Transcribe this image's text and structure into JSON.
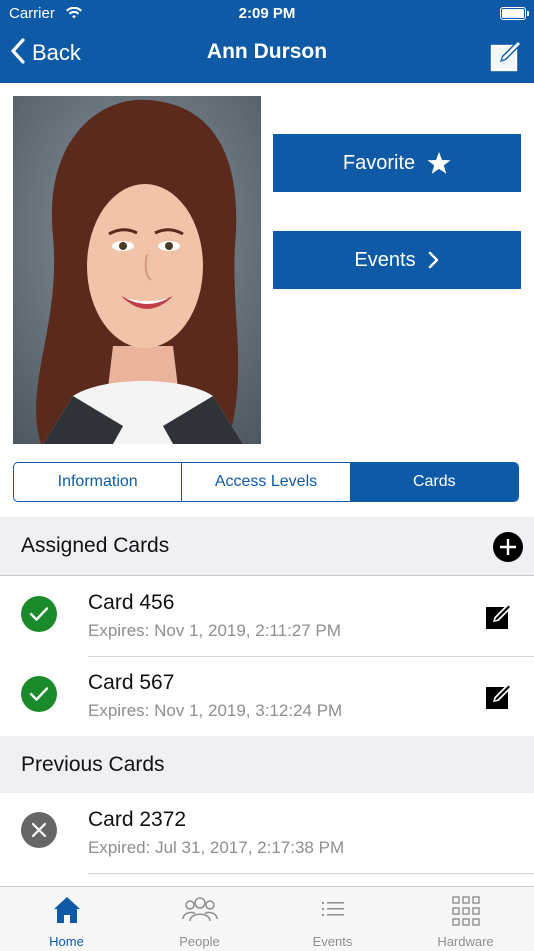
{
  "status_bar": {
    "carrier": "Carrier",
    "time": "2:09 PM"
  },
  "nav": {
    "back_label": "Back",
    "title": "Ann Durson"
  },
  "actions": {
    "favorite_label": "Favorite",
    "events_label": "Events"
  },
  "segments": [
    {
      "label": "Information",
      "active": false
    },
    {
      "label": "Access Levels",
      "active": false
    },
    {
      "label": "Cards",
      "active": true
    }
  ],
  "assigned": {
    "title": "Assigned Cards",
    "cards": [
      {
        "name": "Card 456",
        "expires": "Expires: Nov 1, 2019, 2:11:27 PM",
        "status": "active"
      },
      {
        "name": "Card 567",
        "expires": "Expires: Nov 1, 2019, 3:12:24 PM",
        "status": "active"
      }
    ]
  },
  "previous": {
    "title": "Previous Cards",
    "cards": [
      {
        "name": "Card 2372",
        "expires": "Expired: Jul 31, 2017, 2:17:38 PM",
        "status": "expired"
      }
    ]
  },
  "tabbar": [
    {
      "label": "Home",
      "icon": "home-icon",
      "active": true
    },
    {
      "label": "People",
      "icon": "people-icon",
      "active": false
    },
    {
      "label": "Events",
      "icon": "list-icon",
      "active": false
    },
    {
      "label": "Hardware",
      "icon": "grid-icon",
      "active": false
    }
  ],
  "colors": {
    "brand_blue": "#0e5aa7",
    "active_green": "#1b8a2a",
    "expired_gray": "#666666",
    "section_bg": "#efeff4"
  }
}
